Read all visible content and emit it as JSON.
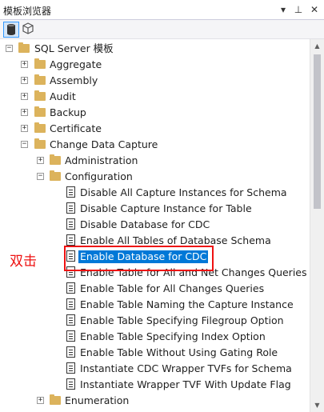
{
  "window": {
    "title": "模板浏览器"
  },
  "tree": {
    "root": "SQL Server 模板",
    "items": {
      "aggregate": "Aggregate",
      "assembly": "Assembly",
      "audit": "Audit",
      "backup": "Backup",
      "certificate": "Certificate",
      "cdc": "Change Data Capture",
      "administration": "Administration",
      "configuration": "Configuration",
      "enumeration": "Enumeration"
    },
    "templates": [
      "Disable All Capture Instances for Schema",
      "Disable Capture Instance for Table",
      "Disable Database for CDC",
      "Enable All Tables of Database Schema",
      "Enable Database for CDC",
      "Enable Table for All and Net Changes Queries",
      "Enable Table for All Changes Queries",
      "Enable Table Naming the Capture Instance",
      "Enable Table Specifying Filegroup Option",
      "Enable Table Specifying Index Option",
      "Enable Table Without Using Gating Role",
      "Instantiate CDC Wrapper TVFs for Schema",
      "Instantiate Wrapper TVF With Update Flag"
    ],
    "selected": "Enable Database for CDC"
  },
  "annotation": {
    "text": "双击",
    "color": "#ee1111"
  },
  "colors": {
    "selection": "#0078d7",
    "folder": "#dcb35c"
  }
}
